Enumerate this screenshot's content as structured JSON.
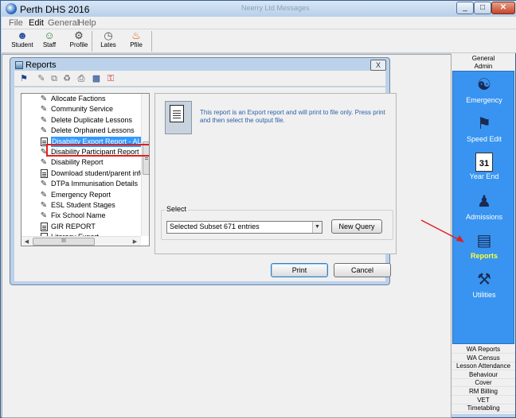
{
  "window": {
    "title": "Perth DHS 2016",
    "ghost_title": "Neerry Ltd  Messages",
    "controls": {
      "minimize": "_",
      "maximize": "□",
      "close": "✕"
    }
  },
  "menu": {
    "file": "File",
    "edit": "Edit",
    "general": "General",
    "help": "Help"
  },
  "toolbar": [
    {
      "label": "Student",
      "icon": "student-icon"
    },
    {
      "label": "Staff",
      "icon": "staff-icon"
    },
    {
      "label": "Profile",
      "icon": "profile-icon"
    },
    {
      "label": "Lates",
      "icon": "lates-clock-icon"
    },
    {
      "label": "Pfile",
      "icon": "fire-icon"
    }
  ],
  "dialog": {
    "title": "Reports",
    "close": "X",
    "report_list": [
      "Allocate Factions",
      "Community Service",
      "Delete Duplicate Lessons",
      "Delete Orphaned Lessons",
      "Disability Export Report - ALL stu",
      "Disability Participant Report",
      "Disability Report",
      "Download student/parent inform",
      "DTPa Immunisation Details",
      "Emergency Report",
      "ESL Student Stages",
      "Fix School Name",
      "GIR REPORT",
      "Literacy Export"
    ],
    "selected_index": 4,
    "hscroll_grip": "III",
    "description": "This report is an Export report and will print to file only. Press print and then select the output file.",
    "select_label": "Select",
    "select_value": "Selected Subset 671 entries",
    "new_query": "New Query",
    "print": "Print",
    "cancel": "Cancel"
  },
  "side_panel": {
    "headers": [
      "General",
      "Admin"
    ],
    "tools": [
      {
        "label": "Emergency",
        "icon": "emergency-icon"
      },
      {
        "label": "Speed Edit",
        "icon": "speed-edit-flag-icon"
      },
      {
        "label": "Year End",
        "icon": "calendar-icon"
      },
      {
        "label": "Admissions",
        "icon": "admissions-icon"
      },
      {
        "label": "Reports",
        "icon": "reports-books-icon",
        "active": true
      },
      {
        "label": "Utilities",
        "icon": "utilities-tools-icon"
      }
    ],
    "calendar_day": "31",
    "bottom_items": [
      "WA Reports",
      "WA Census",
      "Lesson Attendance",
      "Behaviour",
      "Cover",
      "RM Billing",
      "VET",
      "Timetabling"
    ]
  },
  "colors": {
    "side_blue": "#3894f0",
    "annotation_red": "#e02020",
    "selected_blue": "#3399ff"
  }
}
